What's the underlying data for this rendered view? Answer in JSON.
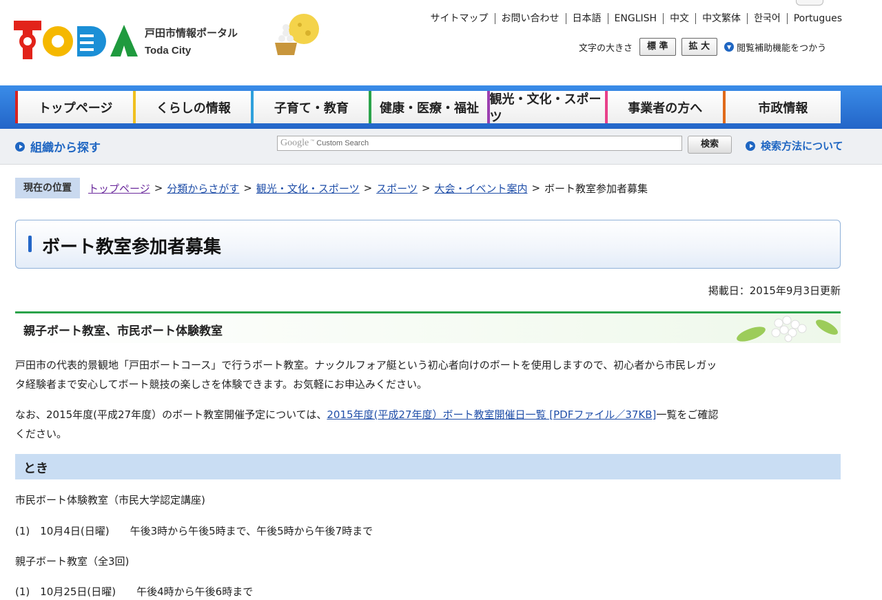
{
  "header": {
    "portal_name": "戸田市情報ポータル",
    "city_name": "Toda City",
    "util_links": [
      "サイトマップ",
      "お問い合わせ",
      "日本語",
      "ENGLISH",
      "中文",
      "中文繁体",
      "한국어",
      "Portugues"
    ],
    "font_size_label": "文字の大きさ",
    "font_standard": "標 準",
    "font_large": "拡 大",
    "a11y_label": "閲覧補助機能をつかう"
  },
  "nav": {
    "items": [
      {
        "label": "トップページ",
        "color": "#d8231f"
      },
      {
        "label": "くらしの情報",
        "color": "#f0c020"
      },
      {
        "label": "子育て・教育",
        "color": "#2ea0dc"
      },
      {
        "label": "健康・医療・福祉",
        "color": "#2aa34a"
      },
      {
        "label": "観光・文化・スポーツ",
        "color": "#9b3fb0"
      },
      {
        "label": "事業者の方へ",
        "color": "#e8408a"
      },
      {
        "label": "市政情報",
        "color": "#e06a1a"
      }
    ]
  },
  "subbar": {
    "org_link": "組織から探す",
    "search_placeholder": "Custom Search",
    "search_brand": "Google",
    "search_button": "検索",
    "how_link": "検索方法について"
  },
  "breadcrumb": {
    "label": "現在の位置",
    "items": [
      "トップページ",
      "分類からさがす",
      "観光・文化・スポーツ",
      "スポーツ",
      "大会・イベント案内"
    ],
    "current": "ボート教室参加者募集"
  },
  "page": {
    "title": "ボート教室参加者募集",
    "posted": "掲載日：2015年9月3日更新",
    "section1_title": "親子ボート教室、市民ボート体験教室",
    "para1_line1": "戸田市の代表的景観地「戸田ボートコース」で行うボート教室。ナックルフォア艇という初心者向けのボートを使用しますので、初心者から市民レガッ",
    "para1_line2": "タ経験者まで安心してボート競技の楽しさを体験できます。お気軽にお申込みください。",
    "para2_before": "なお、2015年度(平成27年度）のボート教室開催予定については、",
    "para2_link": "2015年度(平成27年度）ボート教室開催日一覧 [PDFファイル／37KB]",
    "para2_after": "一覧をご確認",
    "para2_line2": "ください。",
    "section2_title": "とき",
    "line1": "市民ボート体験教室（市民大学認定講座)",
    "line2": "(1)　10月4日(日曜)　　午後3時から午後5時まで、午後5時から午後7時まで",
    "line3": "親子ボート教室（全3回)",
    "line4": "(1)　10月25日(日曜)　　午後4時から午後6時まで"
  }
}
